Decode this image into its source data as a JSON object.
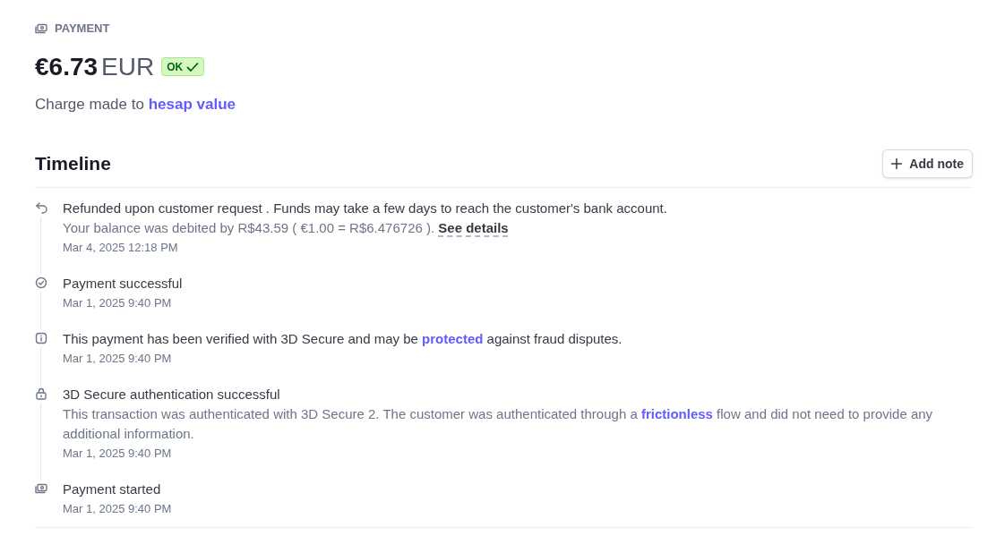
{
  "header": {
    "label": "PAYMENT",
    "amount": "€6.73",
    "currency": "EUR",
    "status_badge": "OK",
    "charge": [
      {
        "kind": "plain",
        "text": "Charge made to "
      },
      {
        "kind": "link",
        "text": "hesap value"
      }
    ]
  },
  "timeline": {
    "title": "Timeline",
    "add_button": "Add note",
    "events": [
      {
        "kind": "refund",
        "title": [
          {
            "kind": "plain",
            "text": "Refunded upon customer request . Funds may take a few days to reach the customer's bank account."
          }
        ],
        "detail": [
          {
            "kind": "plain",
            "text": "Your balance was debited by R$43.59 ( €1.00 = R$6.476726 ). "
          },
          {
            "kind": "details",
            "text": "See details"
          }
        ],
        "time": "Mar 4, 2025 12:18 PM"
      },
      {
        "kind": "check",
        "title": [
          {
            "kind": "plain",
            "text": "Payment successful"
          }
        ],
        "time": "Mar 1, 2025 9:40 PM"
      },
      {
        "kind": "info",
        "title": [
          {
            "kind": "plain",
            "text": "This payment has been verified with 3D Secure and may be "
          },
          {
            "kind": "link",
            "text": "protected"
          },
          {
            "kind": "plain",
            "text": " against fraud disputes."
          }
        ],
        "time": "Mar 1, 2025 9:40 PM"
      },
      {
        "kind": "lock",
        "title": [
          {
            "kind": "plain",
            "text": "3D Secure authentication successful"
          }
        ],
        "detail": [
          {
            "kind": "plain",
            "text": "This transaction was authenticated with 3D Secure 2. The customer was authenticated through a "
          },
          {
            "kind": "link",
            "text": "frictionless"
          },
          {
            "kind": "plain",
            "text": " flow and did not need to provide any additional information."
          }
        ],
        "time": "Mar 1, 2025 9:40 PM"
      },
      {
        "kind": "payment",
        "title": [
          {
            "kind": "plain",
            "text": "Payment started"
          }
        ],
        "time": "Mar 1, 2025 9:40 PM"
      }
    ]
  }
}
